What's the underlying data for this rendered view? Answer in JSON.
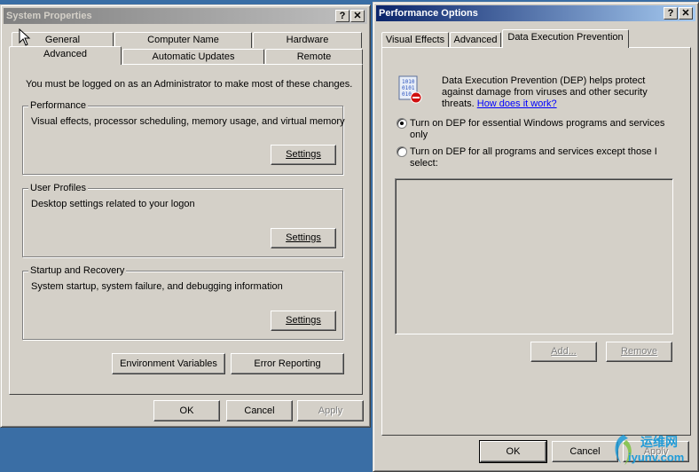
{
  "system_properties": {
    "title": "System Properties",
    "tabs_row1": [
      "General",
      "Computer Name",
      "Hardware"
    ],
    "tabs_row2": [
      "Advanced",
      "Automatic Updates",
      "Remote"
    ],
    "admin_note": "You must be logged on as an Administrator to make most of these changes.",
    "performance": {
      "label": "Performance",
      "description": "Visual effects, processor scheduling, memory usage, and virtual memory",
      "settings_button": "Settings"
    },
    "user_profiles": {
      "label": "User Profiles",
      "description": "Desktop settings related to your logon",
      "settings_button": "Settings"
    },
    "startup_recovery": {
      "label": "Startup and Recovery",
      "description": "System startup, system failure, and debugging information",
      "settings_button": "Settings"
    },
    "env_vars_button": "Environment Variables",
    "error_reporting_button": "Error Reporting",
    "ok_button": "OK",
    "cancel_button": "Cancel",
    "apply_button": "Apply"
  },
  "performance_options": {
    "title": "Performance Options",
    "tabs": [
      "Visual Effects",
      "Advanced",
      "Data Execution Prevention"
    ],
    "dep_description_line1": "Data Execution Prevention (DEP) helps protect",
    "dep_description_line2": "against damage from viruses and other security",
    "dep_description_line3": "threats.",
    "how_link": "How does it work?",
    "radio1_line1": "Turn on DEP for essential Windows programs and services",
    "radio1_line2": "only",
    "radio2_line1": "Turn on DEP for all programs and services except those I",
    "radio2_line2": "select:",
    "radio1_selected": true,
    "add_button": "Add...",
    "remove_button": "Remove",
    "ok_button": "OK",
    "cancel_button": "Cancel",
    "apply_button": "Apply"
  },
  "help_glyph": "?",
  "close_glyph": "✕",
  "watermark": {
    "line1": "运维网",
    "line2": "iyunv.com"
  },
  "icons": {
    "dep_icon": "dep-shield-icon"
  }
}
